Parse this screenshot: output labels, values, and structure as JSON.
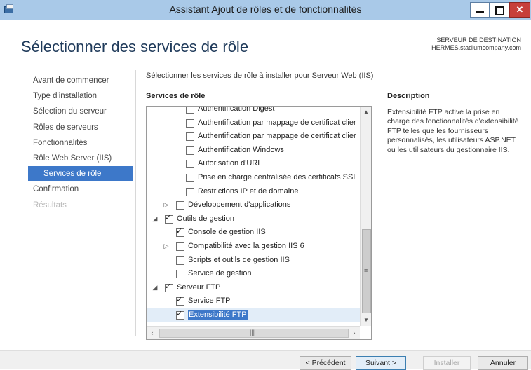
{
  "window": {
    "title": "Assistant Ajout de rôles et de fonctionnalités"
  },
  "page": {
    "title": "Sélectionner des services de rôle",
    "destination_label": "SERVEUR DE DESTINATION",
    "destination_server": "HERMES.stadiumcompany.com"
  },
  "nav": {
    "items": [
      {
        "label": "Avant de commencer",
        "state": "normal"
      },
      {
        "label": "Type d'installation",
        "state": "normal"
      },
      {
        "label": "Sélection du serveur",
        "state": "normal"
      },
      {
        "label": "Rôles de serveurs",
        "state": "normal"
      },
      {
        "label": "Fonctionnalités",
        "state": "normal"
      },
      {
        "label": "Rôle Web Server (IIS)",
        "state": "normal"
      },
      {
        "label": "Services de rôle",
        "state": "active"
      },
      {
        "label": "Confirmation",
        "state": "normal"
      },
      {
        "label": "Résultats",
        "state": "disabled"
      }
    ]
  },
  "main": {
    "instruction": "Sélectionner les services de rôle à installer pour Serveur Web (IIS)",
    "services_header": "Services de rôle",
    "description_header": "Description",
    "description_text": "Extensibilité FTP active la prise en charge des fonctionnalités d'extensibilité FTP telles que les fournisseurs personnalisés, les utilisateurs ASP.NET ou les utilisateurs du gestionnaire IIS."
  },
  "tree": {
    "rows": [
      {
        "label": "Authentification Digest",
        "level": 3,
        "checked": false,
        "expander": "none"
      },
      {
        "label": "Authentification par mappage de certificat clier",
        "level": 3,
        "checked": false,
        "expander": "none"
      },
      {
        "label": "Authentification par mappage de certificat clier",
        "level": 3,
        "checked": false,
        "expander": "none"
      },
      {
        "label": "Authentification Windows",
        "level": 3,
        "checked": false,
        "expander": "none"
      },
      {
        "label": "Autorisation d'URL",
        "level": 3,
        "checked": false,
        "expander": "none"
      },
      {
        "label": "Prise en charge centralisée des certificats SSL",
        "level": 3,
        "checked": false,
        "expander": "none"
      },
      {
        "label": "Restrictions IP et de domaine",
        "level": 3,
        "checked": false,
        "expander": "none"
      },
      {
        "label": "Développement d'applications",
        "level": 2,
        "checked": false,
        "expander": "collapsed"
      },
      {
        "label": "Outils de gestion",
        "level": 1,
        "checked": true,
        "expander": "expanded"
      },
      {
        "label": "Console de gestion IIS",
        "level": 2,
        "checked": true,
        "expander": "none"
      },
      {
        "label": "Compatibilité avec la gestion IIS 6",
        "level": 2,
        "checked": false,
        "expander": "collapsed"
      },
      {
        "label": "Scripts et outils de gestion IIS",
        "level": 2,
        "checked": false,
        "expander": "none"
      },
      {
        "label": "Service de gestion",
        "level": 2,
        "checked": false,
        "expander": "none"
      },
      {
        "label": "Serveur FTP",
        "level": 1,
        "checked": true,
        "expander": "expanded"
      },
      {
        "label": "Service FTP",
        "level": 2,
        "checked": true,
        "expander": "none"
      },
      {
        "label": "Extensibilité FTP",
        "level": 2,
        "checked": true,
        "expander": "none",
        "selected": true
      }
    ]
  },
  "footer": {
    "prev_label": "< Précédent",
    "next_label": "Suivant >",
    "install_label": "Installer",
    "cancel_label": "Annuler"
  },
  "colors": {
    "accent": "#3d78c9",
    "titlebar": "#a9c9e8",
    "close": "#c7403b"
  },
  "icons": {
    "app": "server-manager-icon",
    "minimize": "minimize-icon",
    "maximize": "maximize-icon",
    "close": "close-icon",
    "expanded": "triangle-down-icon",
    "collapsed": "triangle-right-icon",
    "checked": "checkmark-icon"
  }
}
